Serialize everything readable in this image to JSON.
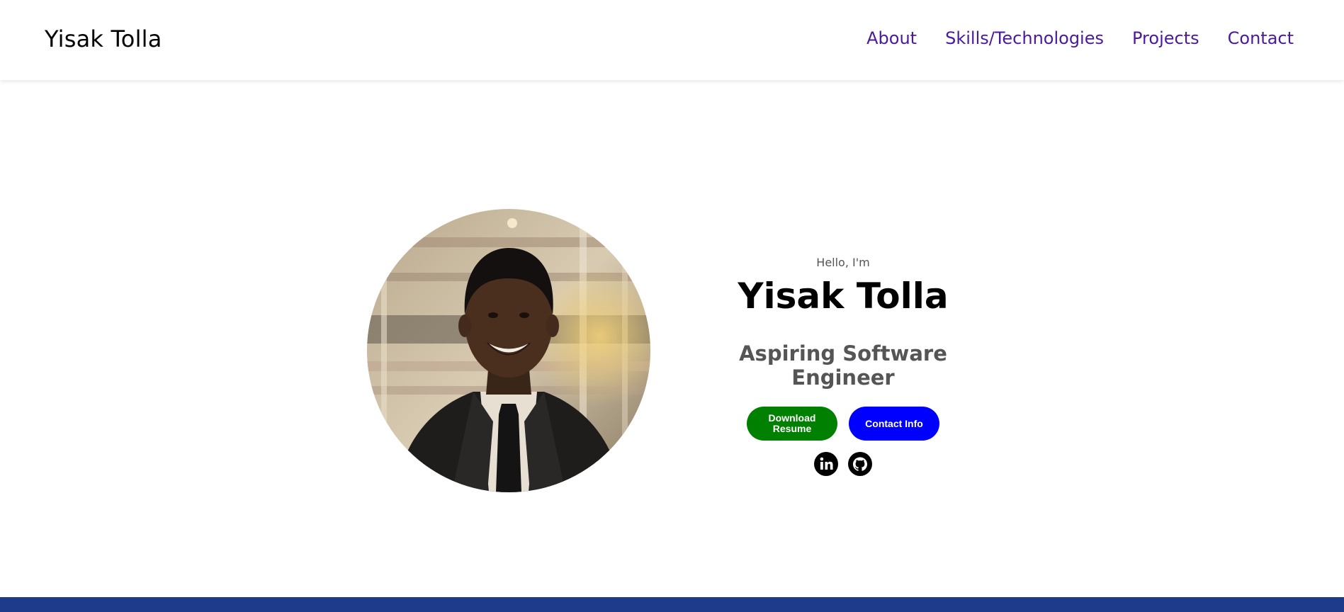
{
  "header": {
    "logo": "Yisak Tolla",
    "nav": [
      {
        "label": "About"
      },
      {
        "label": "Skills/Technologies"
      },
      {
        "label": "Projects"
      },
      {
        "label": "Contact"
      }
    ]
  },
  "hero": {
    "greeting": "Hello, I'm",
    "name": "Yisak Tolla",
    "title": "Aspiring Software Engineer",
    "buttons": {
      "resume": "Download Resume",
      "contact": "Contact Info"
    },
    "socials": [
      {
        "icon": "linkedin-icon"
      },
      {
        "icon": "github-icon"
      }
    ]
  },
  "colors": {
    "nav_link": "#4b1a9a",
    "resume_button": "#008000",
    "contact_button": "#0000ff",
    "footer_bar": "#1e3a8a"
  }
}
